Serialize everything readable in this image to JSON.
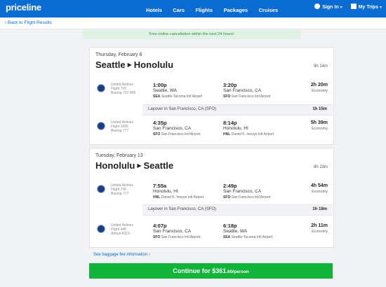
{
  "brand": {
    "logo_text": "priceline"
  },
  "header": {
    "nav": [
      "Hotels",
      "Cars",
      "Flights",
      "Packages",
      "Cruises"
    ],
    "sign_in": "Sign In",
    "my_trips": "My Trips"
  },
  "subnav": {
    "back_label": "Back to Flight Results"
  },
  "notice": "Free online cancellation within the next 24 hours!",
  "outbound": {
    "date": "Thursday, February 8",
    "origin": "Seattle",
    "destination": "Honolulu",
    "total_duration": "9h 14m",
    "segments": [
      {
        "airline": "United Airlines",
        "flight": "Flight 720",
        "aircraft": "Boeing 737-800",
        "dep_time": "1:00p",
        "dep_city": "Seattle, WA",
        "dep_code": "SEA",
        "dep_airport": "Seattle-Tacoma Intl Airport",
        "arr_time": "3:20p",
        "arr_city": "San Francisco, CA",
        "arr_code": "SFO",
        "arr_airport": "San Francisco Intl Airport",
        "duration": "2h 20m",
        "cabin": "Economy"
      },
      {
        "airline": "United Airlines",
        "flight": "Flight 1695",
        "aircraft": "Boeing 777",
        "dep_time": "4:35p",
        "dep_city": "San Francisco, CA",
        "dep_code": "SFO",
        "dep_airport": "San Francisco Intl Airport",
        "arr_time": "8:14p",
        "arr_city": "Honolulu, HI",
        "arr_code": "HNL",
        "arr_airport": "Daniel K. Inouye Intl Airport",
        "duration": "5h 39m",
        "cabin": "Economy"
      }
    ],
    "layover": {
      "text": "Layover in San Francisco, CA (SFO)",
      "duration": "1h 15m"
    }
  },
  "return": {
    "date": "Tuesday, February 13",
    "origin": "Honolulu",
    "destination": "Seattle",
    "total_duration": "8h 23m",
    "segments": [
      {
        "airline": "United Airlines",
        "flight": "Flight 735",
        "aircraft": "Boeing 777",
        "dep_time": "7:55a",
        "dep_city": "Honolulu, HI",
        "dep_code": "HNL",
        "dep_airport": "Daniel K. Inouye Intl Airport",
        "arr_time": "2:49p",
        "arr_city": "San Francisco, CA",
        "arr_code": "SFO",
        "arr_airport": "San Francisco Intl Airport",
        "duration": "4h 54m",
        "cabin": "Economy"
      },
      {
        "airline": "United Airlines",
        "flight": "Flight 445",
        "aircraft": "Airbus A319",
        "dep_time": "4:07p",
        "dep_city": "San Francisco, CA",
        "dep_code": "SFO",
        "dep_airport": "San Francisco Intl Airport",
        "arr_time": "6:18p",
        "arr_city": "Seattle, WA",
        "arr_code": "SEA",
        "arr_airport": "Seattle-Tacoma Intl Airport",
        "duration": "2h 11m",
        "cabin": "Economy"
      }
    ],
    "layover": {
      "text": "Layover in San Francisco, CA (SFO)",
      "duration": "1h 18m"
    }
  },
  "baggage_link": "See baggage fee information",
  "cta": {
    "prefix": "Continue for ",
    "price": "$361",
    "cents": ".60",
    "per": "/person"
  },
  "colors": {
    "brand_blue": "#0a6cd2",
    "cta_green": "#12b339",
    "notice_bg": "#dff2e3",
    "notice_text": "#2f8a4a"
  }
}
